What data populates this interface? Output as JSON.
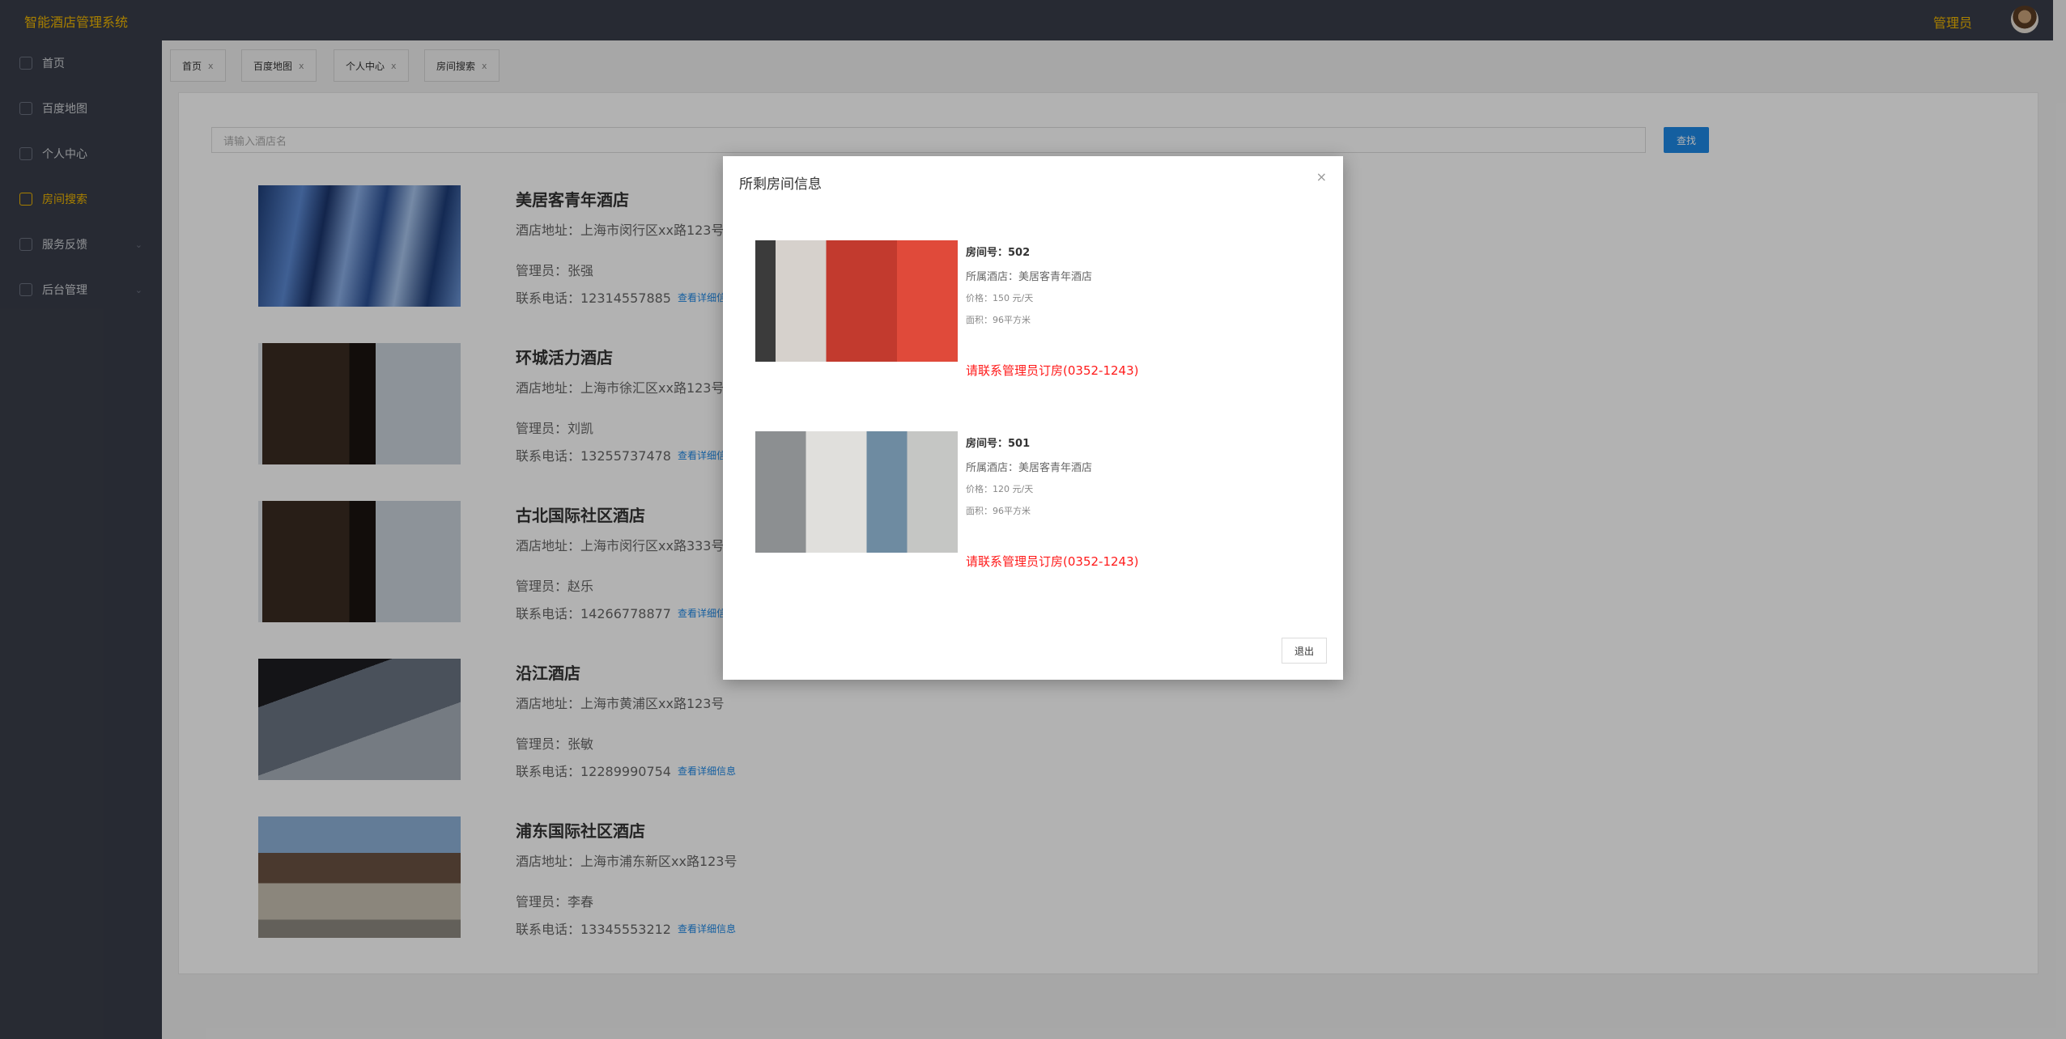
{
  "header": {
    "brand": "智能酒店管理系统",
    "user": "管理员"
  },
  "sidebar": {
    "items": [
      {
        "label": "首页",
        "icon": "home-icon"
      },
      {
        "label": "百度地图",
        "icon": "map-icon"
      },
      {
        "label": "个人中心",
        "icon": "user-icon"
      },
      {
        "label": "房间搜索",
        "icon": "search-icon",
        "active": true
      },
      {
        "label": "服务反馈",
        "icon": "feedback-icon",
        "expandable": true
      },
      {
        "label": "后台管理",
        "icon": "admin-icon",
        "expandable": true
      }
    ]
  },
  "tabs": [
    {
      "label": "首页",
      "close": "x"
    },
    {
      "label": "百度地图",
      "close": "x"
    },
    {
      "label": "个人中心",
      "close": "x"
    },
    {
      "label": "房间搜索",
      "close": "x"
    }
  ],
  "search": {
    "placeholder": "请输入酒店名",
    "button": "查找"
  },
  "hotels": [
    {
      "name": "美居客青年酒店",
      "address": "酒店地址：上海市闵行区xx路123号",
      "manager": "管理员：张强",
      "phone": "联系电话：12314557885",
      "more": "查看详细信息"
    },
    {
      "name": "环城活力酒店",
      "address": "酒店地址：上海市徐汇区xx路123号",
      "manager": "管理员：刘凯",
      "phone": "联系电话：13255737478",
      "more": "查看详细信息"
    },
    {
      "name": "古北国际社区酒店",
      "address": "酒店地址：上海市闵行区xx路333号",
      "manager": "管理员：赵乐",
      "phone": "联系电话：14266778877",
      "more": "查看详细信息"
    },
    {
      "name": "沿江酒店",
      "address": "酒店地址：上海市黄浦区xx路123号",
      "manager": "管理员：张敏",
      "phone": "联系电话：12289990754",
      "more": "查看详细信息"
    },
    {
      "name": "浦东国际社区酒店",
      "address": "酒店地址：上海市浦东新区xx路123号",
      "manager": "管理员：李春",
      "phone": "联系电话：13345553212",
      "more": "查看详细信息"
    }
  ],
  "modal": {
    "title": "所剩房间信息",
    "close": "×",
    "rooms": [
      {
        "number": "房间号：502",
        "hotel": "所属酒店：美居客青年酒店",
        "price": "价格：150 元/天",
        "area": "面积：96平方米",
        "contact": "请联系管理员订房(0352-1243)"
      },
      {
        "number": "房间号：501",
        "hotel": "所属酒店：美居客青年酒店",
        "price": "价格：120 元/天",
        "area": "面积：96平方米",
        "contact": "请联系管理员订房(0352-1243)"
      }
    ],
    "exit": "退出"
  }
}
